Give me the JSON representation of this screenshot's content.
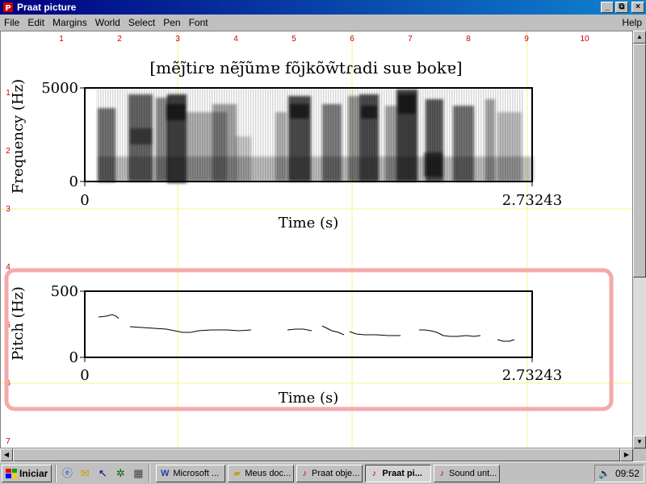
{
  "window": {
    "title": "Praat picture",
    "controls": [
      "_",
      "⧉",
      "×"
    ]
  },
  "menu": {
    "items": [
      "File",
      "Edit",
      "Margins",
      "World",
      "Select",
      "Pen",
      "Font"
    ],
    "help": "Help"
  },
  "ruler": {
    "top": [
      "1",
      "2",
      "3",
      "4",
      "5",
      "6",
      "7",
      "8",
      "9",
      "10"
    ],
    "left": [
      "1",
      "2",
      "3",
      "4",
      "5",
      "6",
      "7"
    ]
  },
  "picture": {
    "transcription": "[mẽj̃tiɾɐ  nẽj̃ũmɐ  fõjkõw̃tɾadi suɐ  bokɐ]",
    "spectrogram": {
      "ylabel": "Frequency (Hz)",
      "ytick_top": "5000",
      "ytick_bottom": "0",
      "xtick_left": "0",
      "xtick_right": "2.73243",
      "xlabel": "Time (s)"
    },
    "pitch": {
      "ylabel": "Pitch (Hz)",
      "ytick_top": "500",
      "ytick_bottom": "0",
      "xtick_left": "0",
      "xtick_right": "2.73243",
      "xlabel": "Time (s)"
    },
    "colors": {
      "guide": "#f4f48c",
      "selection": "#f4aaaa",
      "ruler": "#cc0000"
    }
  },
  "taskbar": {
    "start": "Iniciar",
    "tasks": [
      {
        "icon": "word-icon",
        "label": "Microsoft ..."
      },
      {
        "icon": "folder-icon",
        "label": "Meus doc..."
      },
      {
        "icon": "praat-icon",
        "label": "Praat obje..."
      },
      {
        "icon": "praat-icon",
        "label": "Praat pi...",
        "active": true
      },
      {
        "icon": "praat-icon",
        "label": "Sound unt..."
      }
    ],
    "clock": "09:52"
  }
}
